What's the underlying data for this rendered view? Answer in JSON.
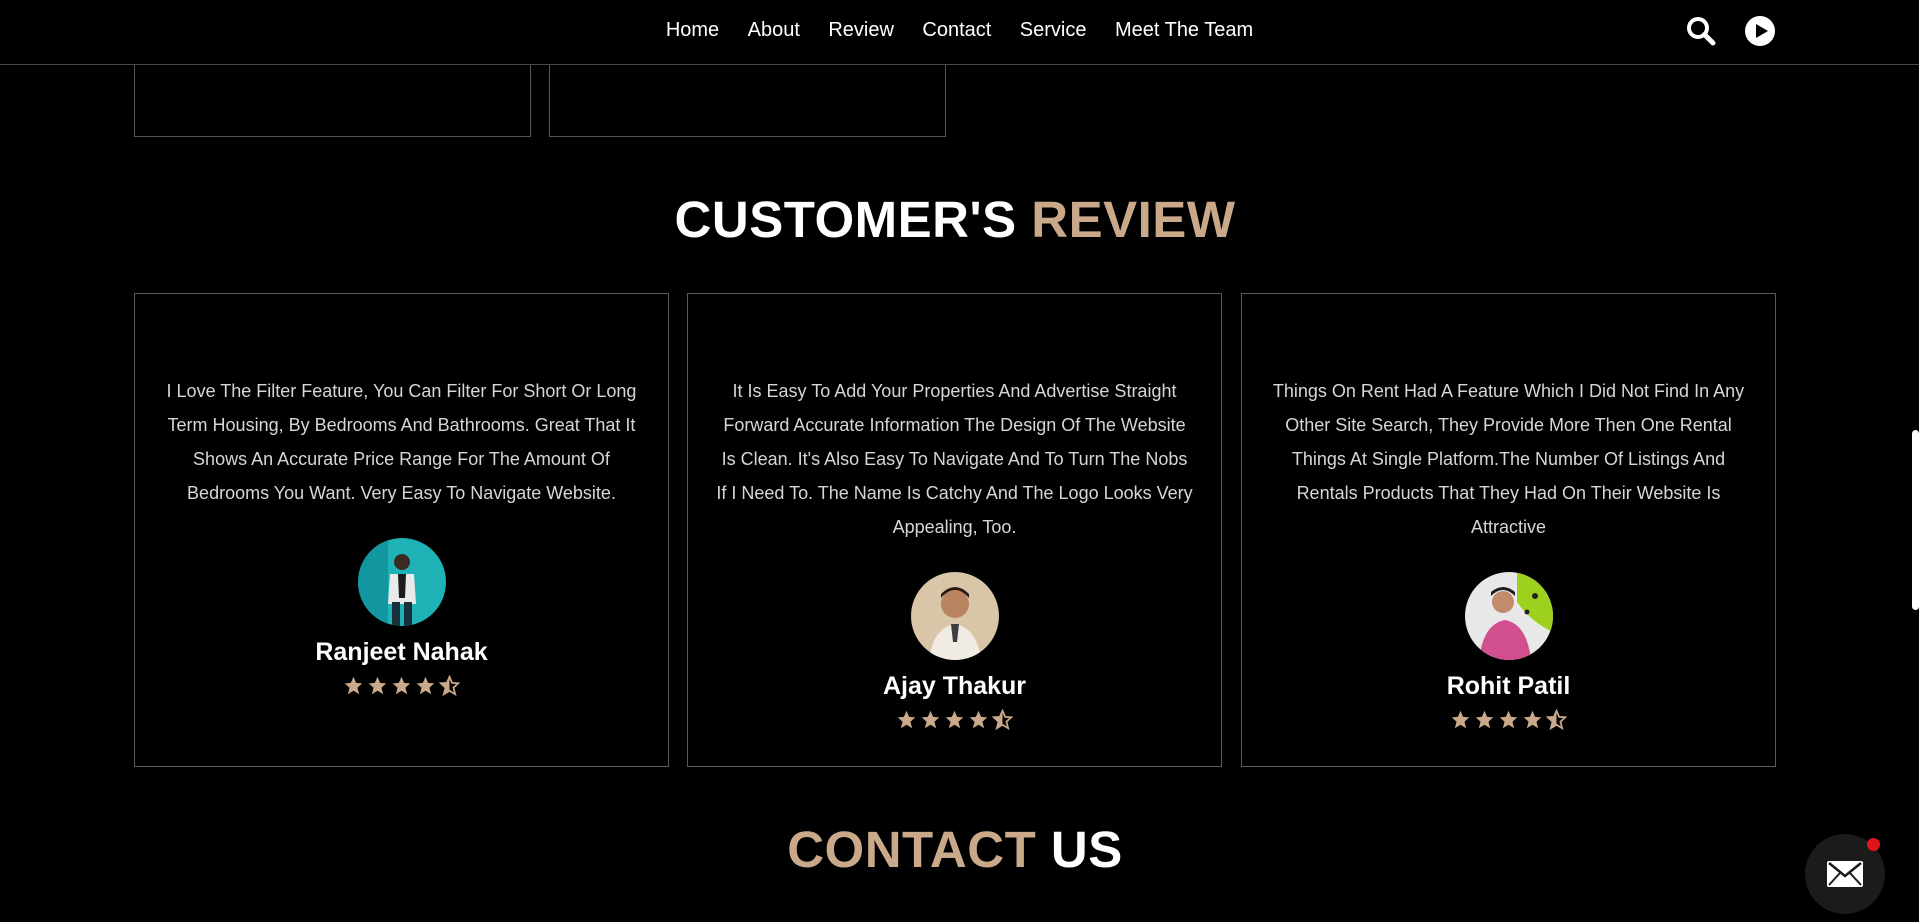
{
  "nav": {
    "links": [
      "Home",
      "About",
      "Review",
      "Contact",
      "Service",
      "Meet The Team"
    ]
  },
  "icons": {
    "search": "search-icon",
    "play": "play-icon",
    "chat": "envelope-icon",
    "star": "star-icon",
    "star_half": "star-half-icon"
  },
  "review_section": {
    "title_main": "CUSTOMER'S",
    "title_accent": "REVIEW"
  },
  "reviews": [
    {
      "text": "I Love The Filter Feature, You Can Filter For Short Or Long Term Housing, By Bedrooms And Bathrooms. Great That It Shows An Accurate Price Range For The Amount Of Bedrooms You Want. Very Easy To Navigate Website.",
      "name": "Ranjeet Nahak",
      "rating": 4.5
    },
    {
      "text": "It Is Easy To Add Your Properties And Advertise Straight Forward Accurate Information The Design Of The Website Is Clean. It's Also Easy To Navigate And To Turn The Nobs If I Need To. The Name Is Catchy And The Logo Looks Very Appealing, Too.",
      "name": "Ajay Thakur",
      "rating": 4.5
    },
    {
      "text": "Things On Rent Had A Feature Which I Did Not Find In Any Other Site Search, They Provide More Then One Rental Things At Single Platform.The Number Of Listings And Rentals Products That They Had On Their Website Is Attractive",
      "name": "Rohit Patil",
      "rating": 4.5
    }
  ],
  "contact_section": {
    "title_accent": "CONTACT",
    "title_main": "US"
  },
  "colors": {
    "accent": "#c9a98a",
    "background": "#000000",
    "notification": "#e0141b"
  }
}
